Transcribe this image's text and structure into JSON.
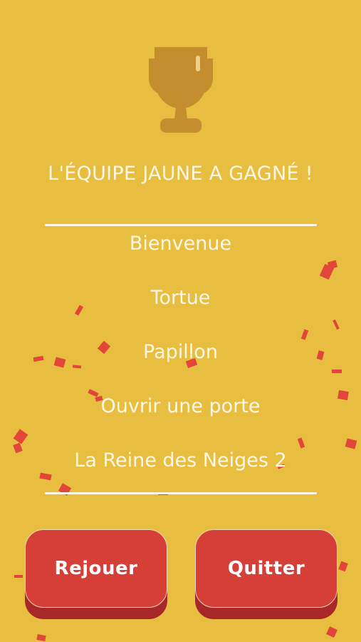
{
  "colors": {
    "background": "#E8BE40",
    "text": "#FFF7E6",
    "trophy": "#C48E2F",
    "confetti": "#E2453A",
    "button": "#D63F38",
    "button_shadow": "#A8282A"
  },
  "header": {
    "icon": "trophy-icon",
    "title": "L'ÉQUIPE JAUNE A GAGNÉ !"
  },
  "words": [
    "Bienvenue",
    "Tortue",
    "Papillon",
    "Ouvrir une porte",
    "La Reine des Neiges 2"
  ],
  "buttons": {
    "replay_label": "Rejouer",
    "quit_label": "Quitter"
  }
}
